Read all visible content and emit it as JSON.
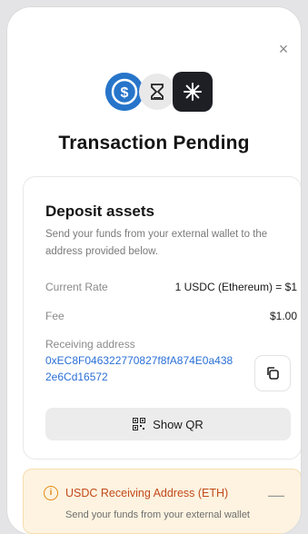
{
  "modal": {
    "close_icon": "×",
    "title": "Transaction Pending"
  },
  "icons": {
    "first": "usdc-icon",
    "second": "hourglass-icon",
    "third": "asterisk-icon",
    "hourglass_glyph": "⌛",
    "asterisk_glyph": "✳"
  },
  "deposit": {
    "title": "Deposit assets",
    "description": "Send your funds from your external wallet to the address provided below.",
    "rate_label": "Current Rate",
    "rate_value": "1 USDC (Ethereum) = $1",
    "fee_label": "Fee",
    "fee_value": "$1.00",
    "receiving_label": "Receiving address",
    "address": "0xEC8F046322770827f8fA874E0a4382e6Cd16572",
    "show_qr_label": "Show QR"
  },
  "notice": {
    "info_glyph": "i",
    "title": "USDC Receiving Address (ETH)",
    "description": "Send your funds from your external wallet",
    "collapse_glyph": "—"
  },
  "colors": {
    "usdc_blue": "#2775ca",
    "link_blue": "#2a6fd6",
    "warning_orange": "#e08a12",
    "warning_text": "#c24a1b"
  }
}
